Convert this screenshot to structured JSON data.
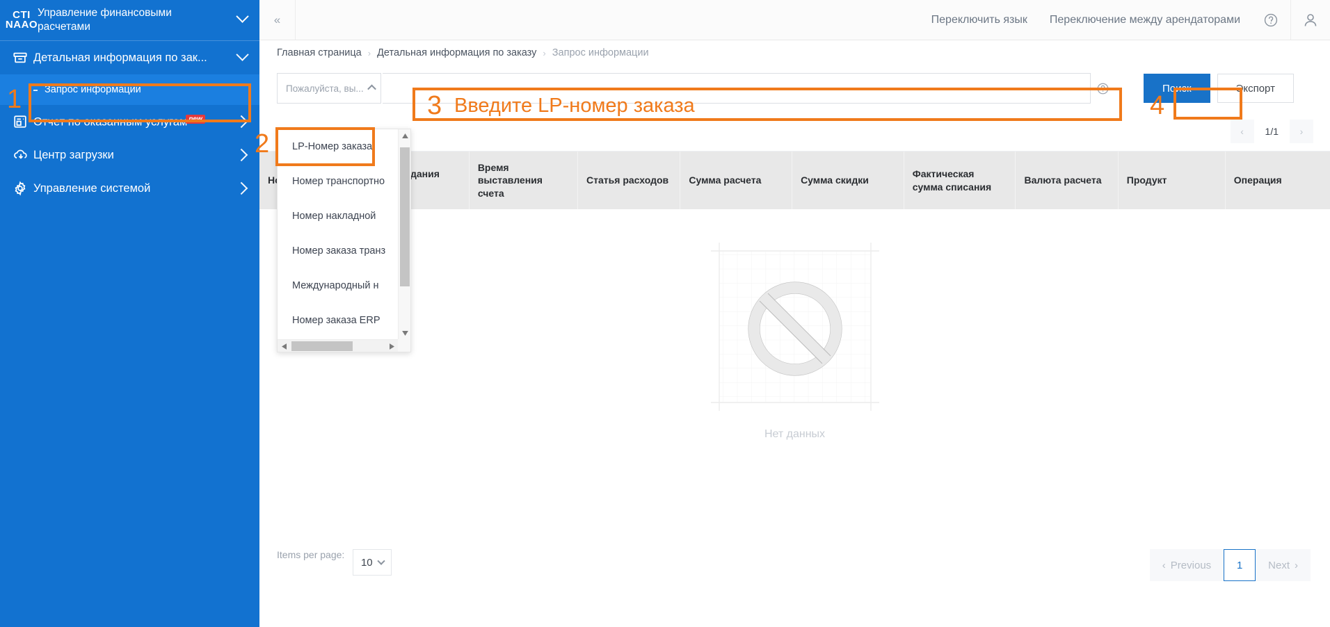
{
  "sidebar": {
    "logo_line1": "CTI",
    "logo_line2": "NAAO",
    "title": "Управление финансовыми расчетами",
    "items": [
      {
        "label": "Детальная информация по зак...",
        "icon": "archive-icon",
        "arrow": "chevron-down-icon"
      },
      {
        "label": "Отчет по оказанным услугам",
        "icon": "report-icon",
        "arrow": "chevron-right-icon",
        "badge": "new"
      },
      {
        "label": "Центр загрузки",
        "icon": "cloud-download-icon",
        "arrow": "chevron-right-icon"
      },
      {
        "label": "Управление системой",
        "icon": "gear-icon",
        "arrow": "chevron-right-icon"
      }
    ],
    "sub_item": {
      "label": "Запрос информации"
    }
  },
  "topbar": {
    "collapse_icon": "double-chevron-left-icon",
    "language_switch": "Переключить язык",
    "tenant_switch": "Переключение между арендаторами",
    "help_icon": "question-circle-icon",
    "user_icon": "user-avatar-icon"
  },
  "breadcrumb": {
    "items": [
      "Главная страница",
      "Детальная информация по заказу",
      "Запрос информации"
    ],
    "separator": "›"
  },
  "filter": {
    "select_placeholder": "Пожалуйста, вы...",
    "select_caret": "chevron-up-icon",
    "search_value": "",
    "search_placeholder": "",
    "help_icon": "question-circle-icon",
    "search_button": "Поиск",
    "export_button": "Экспорт"
  },
  "dropdown": {
    "options": [
      "LP-Номер заказа",
      "Номер транспортно",
      "Номер накладной",
      "Номер заказа транз",
      "Международный н",
      "Номер заказа ERP"
    ],
    "selected": "LP-Номер заказа"
  },
  "pager_top": {
    "prev_icon": "chevron-left-icon",
    "count": "1/1",
    "next_icon": "chevron-right-icon"
  },
  "table": {
    "columns": [
      "Номер заказа",
      "Дата создания заказа",
      "Время выставления счета",
      "Статья расходов",
      "Сумма расчета",
      "Сумма скидки",
      "Фактическая сумма списания",
      "Валюта расчета",
      "Продукт",
      "Операция"
    ],
    "empty_text": "Нет данных",
    "empty_icon": "no-data-icon"
  },
  "bottom": {
    "items_per_page_label": "Items per page:",
    "items_per_page_value": "10",
    "items_per_page_caret": "chevron-down-icon",
    "previous_label": "Previous",
    "previous_icon": "chevron-left-icon",
    "current_page": "1",
    "next_label": "Next",
    "next_icon": "chevron-right-icon"
  },
  "annotations": {
    "step1": "1",
    "step2": "2",
    "step3": "3",
    "step3_text": "Введите LP-номер заказа",
    "step4": "4"
  },
  "colors": {
    "sidebar_bg": "#1272d0",
    "sidebar_active": "#1b7fe0",
    "accent": "#1872c8",
    "annotation": "#f07a1b",
    "badge_red": "#e4393c",
    "table_header_bg": "#e8e8e8"
  }
}
